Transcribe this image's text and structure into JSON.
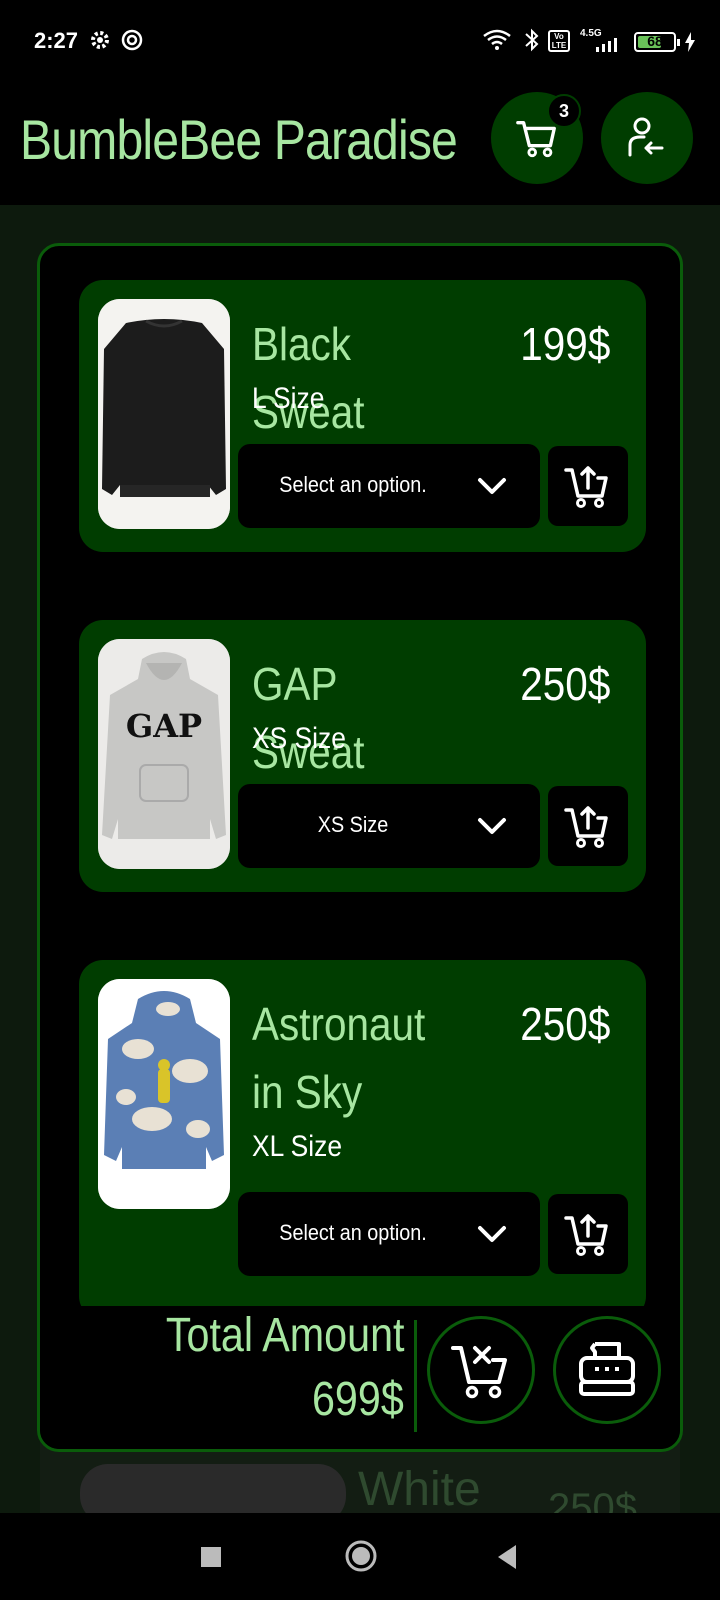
{
  "status_bar": {
    "time": "2:27",
    "network": "4.5G",
    "volte": "Vo LTE",
    "battery": "68",
    "battery_level": 0.68
  },
  "app_bar": {
    "title": "BumbleBee Paradise",
    "cart_badge": "3",
    "cart_icon": "cart-icon",
    "account_icon": "account-logout-icon"
  },
  "cart": {
    "items": [
      {
        "title": "Black Sweat",
        "price": "199$",
        "size": "L Size",
        "select_value": "Select an option.",
        "image": "black-sweatshirt"
      },
      {
        "title": "GAP Sweat",
        "price": "250$",
        "size": "XS Size",
        "select_value": "XS Size",
        "image": "gap-grey-hoodie"
      },
      {
        "title": "Astronaut in Sky",
        "price": "250$",
        "size": "XL Size",
        "select_value": "Select an option.",
        "image": "astronaut-tie-dye-hoodie"
      }
    ],
    "total_label": "Total Amount",
    "total_value": "699$"
  },
  "background": {
    "next_item_title": "White",
    "next_item_price": "250$"
  },
  "colors": {
    "accent_green": "#a7e6a1",
    "card_green": "#003d00",
    "border_green": "#0a5c0a",
    "background": "#000000"
  }
}
